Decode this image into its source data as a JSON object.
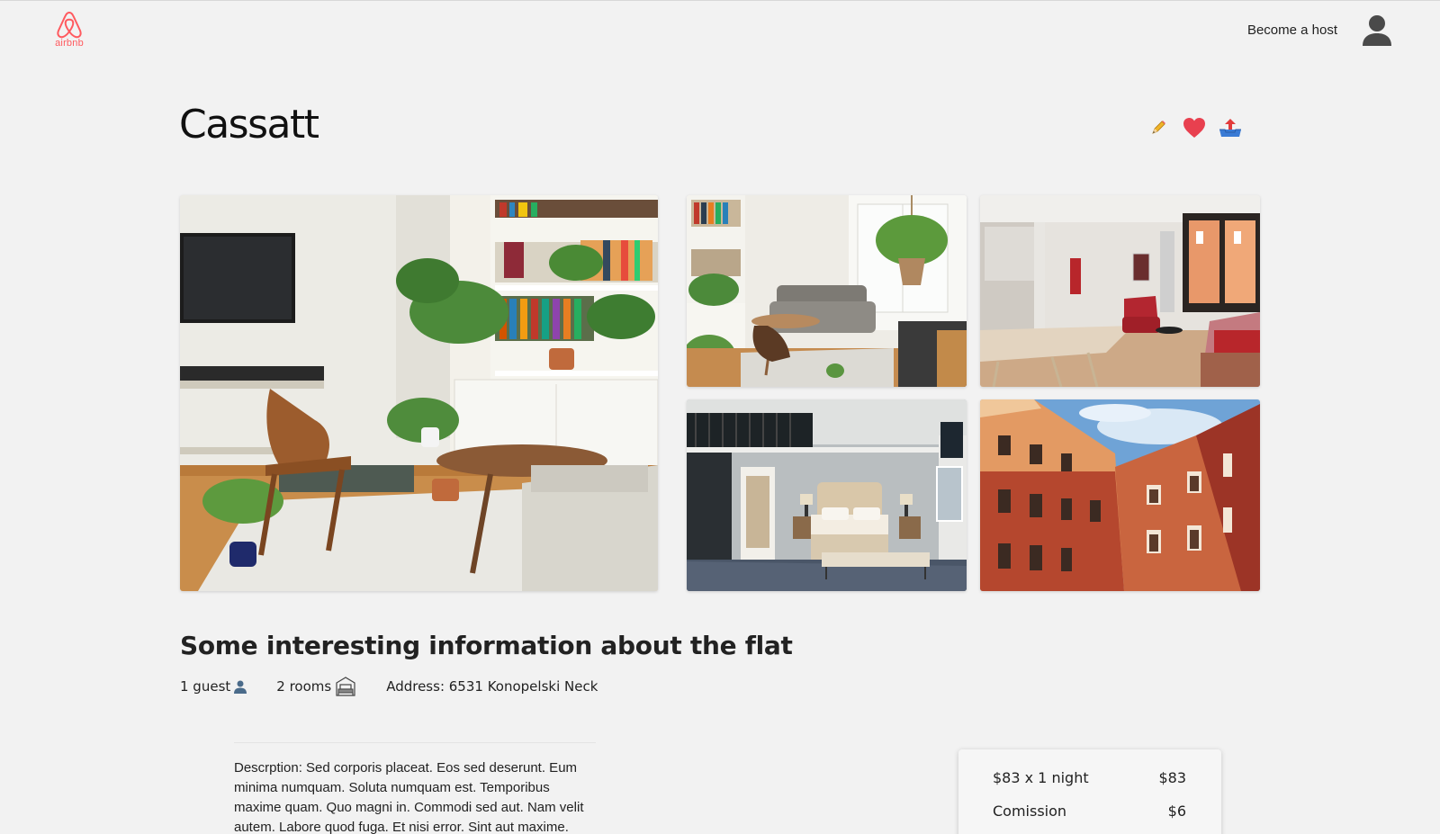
{
  "header": {
    "logo_text": "airbnb",
    "become_host": "Become a host",
    "brand_color": "#ff5a5f"
  },
  "listing": {
    "title": "Cassatt",
    "actions": [
      {
        "name": "edit",
        "icon": "pencil-icon"
      },
      {
        "name": "favorite",
        "icon": "heart-icon"
      },
      {
        "name": "share",
        "icon": "share-tray-icon"
      }
    ],
    "photos": [
      {
        "name": "photo-main",
        "alt": "living-room-with-plants"
      },
      {
        "name": "photo-1",
        "alt": "living-room-sofa"
      },
      {
        "name": "photo-2",
        "alt": "open-plan-kitchen-dining"
      },
      {
        "name": "photo-3",
        "alt": "bedroom"
      },
      {
        "name": "photo-4",
        "alt": "building-courtyard"
      }
    ]
  },
  "info": {
    "heading": "Some interesting information about the flat",
    "guests": "1 guest",
    "rooms": "2 rooms",
    "address": "Address: 6531 Konopelski Neck",
    "description": "Descrption: Sed corporis placeat. Eos sed deserunt. Eum minima numquam. Soluta numquam est. Temporibus maxime quam. Quo magni in. Commodi sed aut. Nam velit autem. Labore quod fuga. Et nisi error. Sint aut maxime."
  },
  "price": {
    "rows": [
      {
        "label": "$83 x 1 night",
        "value": "$83"
      },
      {
        "label": "Comission",
        "value": "$6"
      }
    ]
  }
}
